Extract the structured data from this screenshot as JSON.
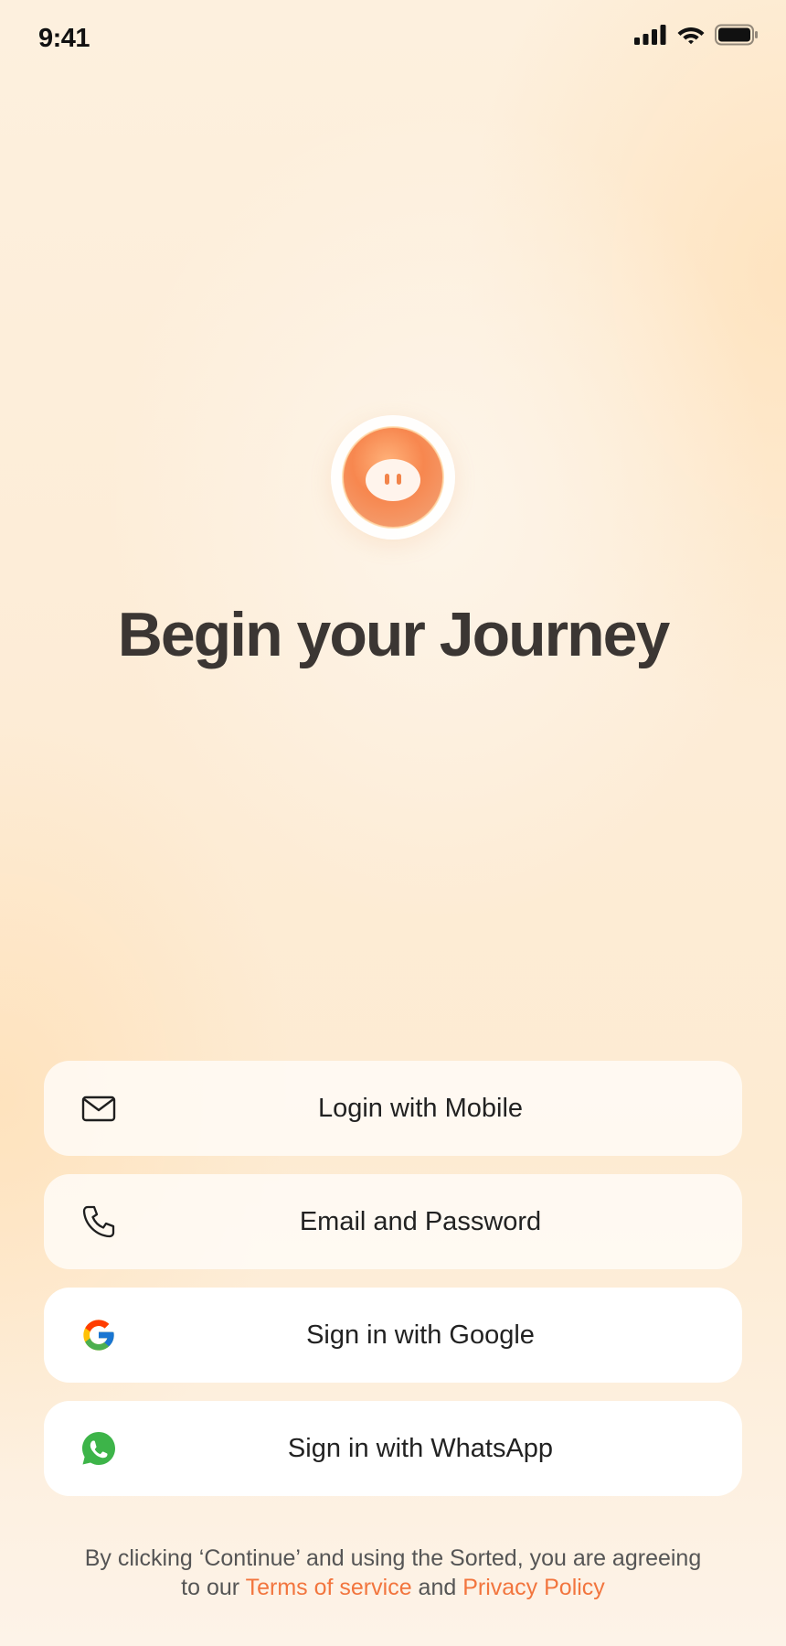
{
  "status_bar": {
    "time": "9:41"
  },
  "brand": {
    "accent": "#f2753e",
    "logo_color": "#f5894f"
  },
  "headline": "Begin your Journey",
  "buttons": [
    {
      "label": "Login with Mobile",
      "icon": "mail-icon"
    },
    {
      "label": "Email and Password",
      "icon": "phone-icon"
    },
    {
      "label": "Sign in with Google",
      "icon": "google-icon"
    },
    {
      "label": "Sign in with WhatsApp",
      "icon": "whatsapp-icon"
    }
  ],
  "footer": {
    "line1": "By clicking ‘Continue’ and using the Sorted, you are agreeing",
    "prefix": "to our",
    "terms": "Terms of service",
    "conjunction": "and",
    "privacy": "Privacy Policy"
  }
}
